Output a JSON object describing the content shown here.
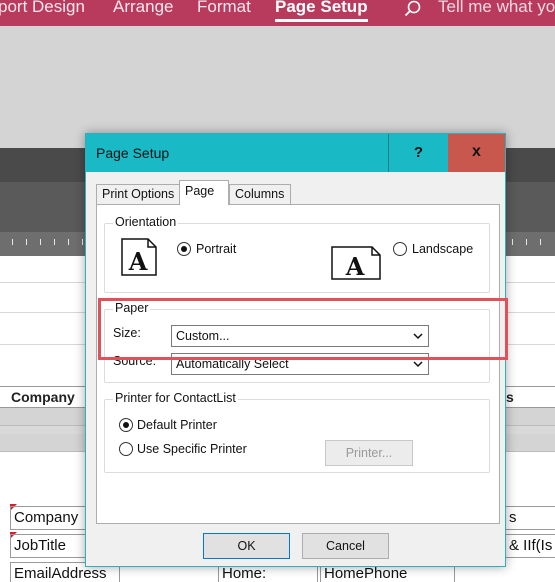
{
  "ribbon": {
    "tabs": [
      {
        "label": "port Design",
        "active": false
      },
      {
        "label": "Arrange",
        "active": false
      },
      {
        "label": "Format",
        "active": false
      },
      {
        "label": "Page Setup",
        "active": true
      }
    ],
    "search_icon": "search-icon",
    "tell_me": "Tell me what yo"
  },
  "report": {
    "header_cells": [
      "Company",
      "s"
    ],
    "detail_fields": [
      "Company",
      "JobTitle",
      "EmailAddress",
      "Home:",
      "HomePhone",
      "s",
      "& IIf(Is"
    ]
  },
  "dialog": {
    "title": "Page Setup",
    "help_label": "?",
    "close_label": "x",
    "tabs": [
      "Print Options",
      "Page",
      "Columns"
    ],
    "active_tab": "Page",
    "orientation": {
      "label": "Orientation",
      "portrait": "Portrait",
      "landscape": "Landscape",
      "selected": "Portrait",
      "page_glyph": "A"
    },
    "paper": {
      "label": "Paper",
      "size_label": "Size:",
      "size_value": "Custom...",
      "source_label": "Source:",
      "source_value": "Automatically Select"
    },
    "printer": {
      "label": "Printer for ContactList",
      "default": "Default Printer",
      "specific": "Use Specific Printer",
      "selected": "Default Printer",
      "printer_button": "Printer..."
    },
    "ok_label": "OK",
    "cancel_label": "Cancel"
  },
  "colors": {
    "ribbon": "#b83b5e",
    "titlebar": "#1ab9c6",
    "close": "#c8584e",
    "highlight": "#e0525b"
  }
}
